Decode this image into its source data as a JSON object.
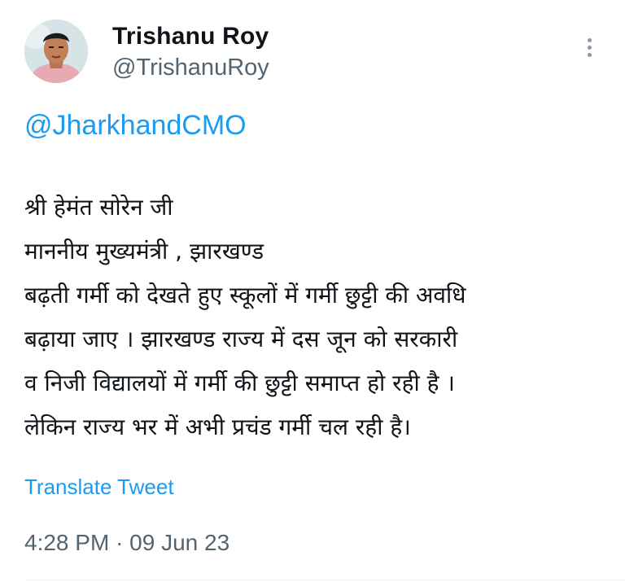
{
  "author": {
    "display_name": "Trishanu Roy",
    "handle": "@TrishanuRoy",
    "avatar": "profile-photo"
  },
  "menu": {
    "icon": "more-vertical-icon"
  },
  "tweet": {
    "mention": "@JharkhandCMO",
    "lines": [
      "श्री हेमंत सोरेन जी",
      "माननीय मुख्यमंत्री , झारखण्ड",
      "बढ़ती गर्मी को देखते हुए स्कूलों में गर्मी छुट्टी की अवधि",
      "बढ़ाया जाए । झारखण्ड राज्य में दस जून को सरकारी",
      "व निजी विद्यालयों में गर्मी की छुट्टी समाप्त हो रही है ।",
      "लेकिन राज्य भर में अभी प्रचंड गर्मी चल रही है।"
    ],
    "translate_label": "Translate Tweet",
    "time": "4:28 PM",
    "separator": "·",
    "date": "09 Jun 23"
  },
  "colors": {
    "link": "#1d9bf0",
    "secondary_text": "#536471",
    "primary_text": "#0f1419"
  }
}
